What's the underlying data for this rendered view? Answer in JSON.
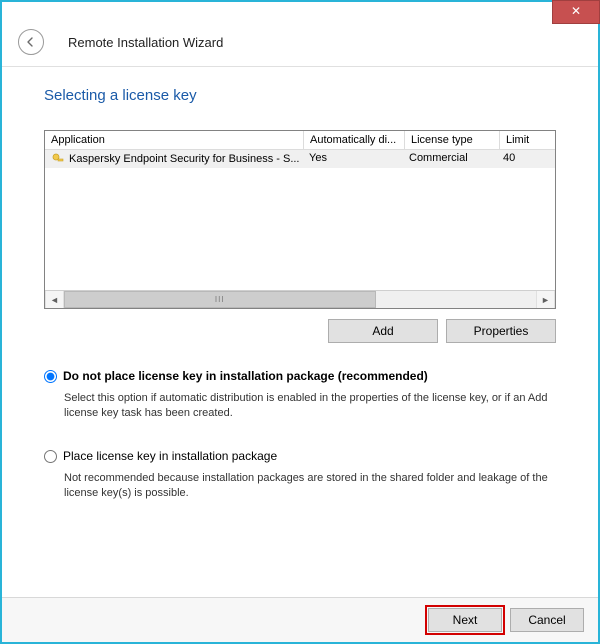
{
  "window": {
    "title": "Remote Installation Wizard",
    "close_x": "✕"
  },
  "step_title": "Selecting a license key",
  "listview": {
    "headers": {
      "application": "Application",
      "auto": "Automatically di...",
      "license_type": "License type",
      "limit": "Limit"
    },
    "rows": [
      {
        "application": "Kaspersky Endpoint Security for Business - S...",
        "auto": "Yes",
        "license_type": "Commercial",
        "limit": "40"
      }
    ]
  },
  "buttons": {
    "add": "Add",
    "properties": "Properties",
    "next": "Next",
    "cancel": "Cancel"
  },
  "options": {
    "opt1_label": "Do not place license key in installation package (recommended)",
    "opt1_desc": "Select this option if automatic distribution is enabled in the properties of the license key, or if an Add license key task has been created.",
    "opt2_label": "Place license key in installation package",
    "opt2_desc": "Not recommended because installation packages are stored in the shared folder and leakage of the license key(s) is possible."
  },
  "scroll_thumb": "III"
}
